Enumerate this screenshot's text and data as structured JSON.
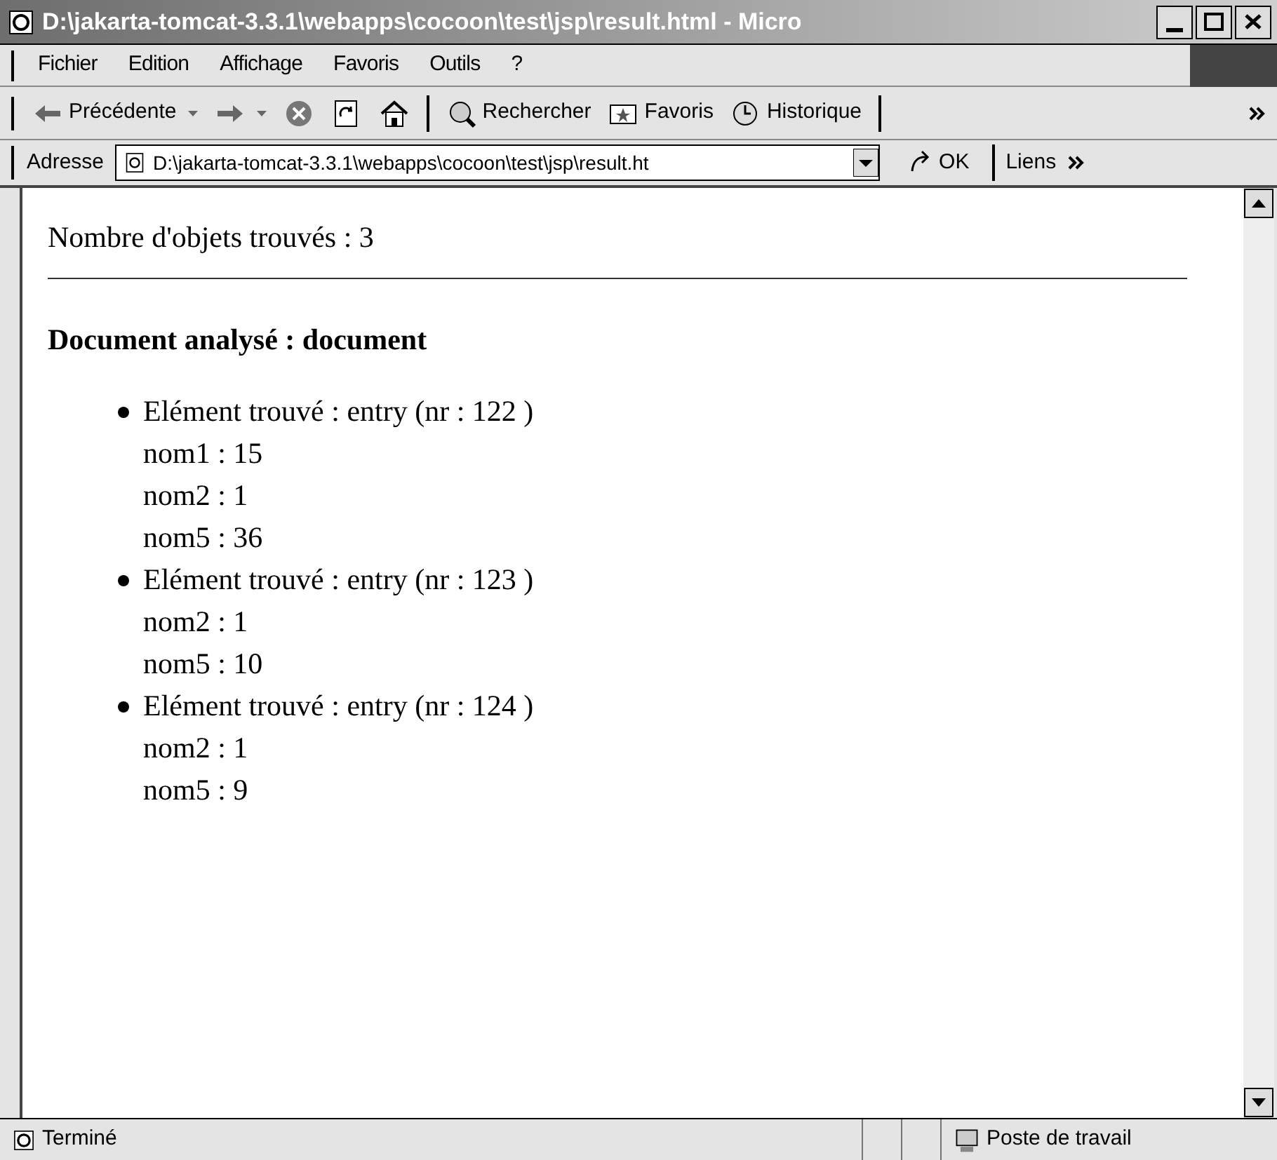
{
  "window": {
    "title": "D:\\jakarta-tomcat-3.3.1\\webapps\\cocoon\\test\\jsp\\result.html - Micro"
  },
  "menu": [
    "Fichier",
    "Edition",
    "Affichage",
    "Favoris",
    "Outils",
    "?"
  ],
  "toolbar": [
    {
      "kind": "back",
      "label": "Précédente"
    },
    {
      "kind": "forward"
    },
    {
      "kind": "stop"
    },
    {
      "kind": "refresh"
    },
    {
      "kind": "home"
    },
    {
      "kind": "search",
      "label": "Rechercher"
    },
    {
      "kind": "favorites",
      "label": "Favoris"
    },
    {
      "kind": "history",
      "label": "Historique"
    }
  ],
  "address_bar": {
    "label": "Adresse",
    "value": "D:\\jakarta-tomcat-3.3.1\\webapps\\cocoon\\test\\jsp\\result.ht",
    "go": "OK",
    "links": "Liens"
  },
  "page": {
    "count": "Nombre d'objets trouvés : 3",
    "heading": "Document analysé : document",
    "entries": [
      {
        "title": "Elément trouvé : entry (nr : 122 )",
        "fields": [
          "nom1 : 15",
          "nom2 : 1",
          "nom5 : 36"
        ]
      },
      {
        "title": "Elément trouvé : entry (nr : 123 )",
        "fields": [
          "nom2 : 1",
          "nom5 : 10"
        ]
      },
      {
        "title": "Elément trouvé : entry (nr : 124 )",
        "fields": [
          "nom2 : 1",
          "nom5 : 9"
        ]
      }
    ]
  },
  "status_bar": {
    "text": "Terminé",
    "zone": "Poste de travail"
  }
}
